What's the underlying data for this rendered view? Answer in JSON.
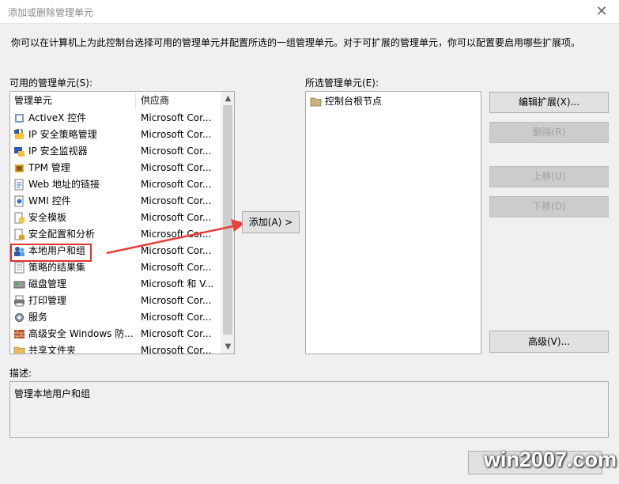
{
  "window": {
    "title": "添加或删除管理单元",
    "close_glyph": "✕"
  },
  "description": "你可以在计算机上为此控制台选择可用的管理单元并配置所选的一组管理单元。对于可扩展的管理单元，你可以配置要启用哪些扩展项。",
  "available": {
    "label": "可用的管理单元(S):",
    "columns": [
      "管理单元",
      "供应商"
    ],
    "items": [
      {
        "name": "ActiveX 控件",
        "vendor": "Microsoft Cor...",
        "icon": "activex-icon"
      },
      {
        "name": "IP 安全策略管理",
        "vendor": "Microsoft Cor...",
        "icon": "ip-security-policy-icon"
      },
      {
        "name": "IP 安全监视器",
        "vendor": "Microsoft Cor...",
        "icon": "ip-security-monitor-icon"
      },
      {
        "name": "TPM 管理",
        "vendor": "Microsoft Cor...",
        "icon": "tpm-icon"
      },
      {
        "name": "Web 地址的链接",
        "vendor": "Microsoft Cor...",
        "icon": "web-link-icon"
      },
      {
        "name": "WMI 控件",
        "vendor": "Microsoft Cor...",
        "icon": "wmi-icon"
      },
      {
        "name": "安全模板",
        "vendor": "Microsoft Cor...",
        "icon": "security-template-icon"
      },
      {
        "name": "安全配置和分析",
        "vendor": "Microsoft Cor...",
        "icon": "security-config-icon"
      },
      {
        "name": "本地用户和组",
        "vendor": "Microsoft Cor...",
        "icon": "local-users-icon"
      },
      {
        "name": "策略的结果集",
        "vendor": "Microsoft Cor...",
        "icon": "rsop-icon"
      },
      {
        "name": "磁盘管理",
        "vendor": "Microsoft 和 V...",
        "icon": "disk-icon"
      },
      {
        "name": "打印管理",
        "vendor": "Microsoft Cor...",
        "icon": "print-icon"
      },
      {
        "name": "服务",
        "vendor": "Microsoft Cor...",
        "icon": "services-gear-icon"
      },
      {
        "name": "高级安全 Windows 防...",
        "vendor": "Microsoft Cor...",
        "icon": "firewall-icon"
      },
      {
        "name": "共享文件夹",
        "vendor": "Microsoft Cor...",
        "icon": "shared-folder-icon"
      }
    ]
  },
  "add_button": "添加(A) >",
  "selected": {
    "label": "所选管理单元(E):",
    "items": [
      {
        "name": "控制台根节点",
        "icon": "folder-icon"
      }
    ]
  },
  "buttons": {
    "edit_extensions": "编辑扩展(X)...",
    "remove": "删除(R)",
    "move_up": "上移(U)",
    "move_down": "下移(D)",
    "advanced": "高级(V)..."
  },
  "description_box": {
    "label": "描述:",
    "text": "管理本地用户和组"
  },
  "watermark": "win2007.com",
  "colors": {
    "highlight": "#e0322f",
    "arrow": "#e8403a"
  }
}
